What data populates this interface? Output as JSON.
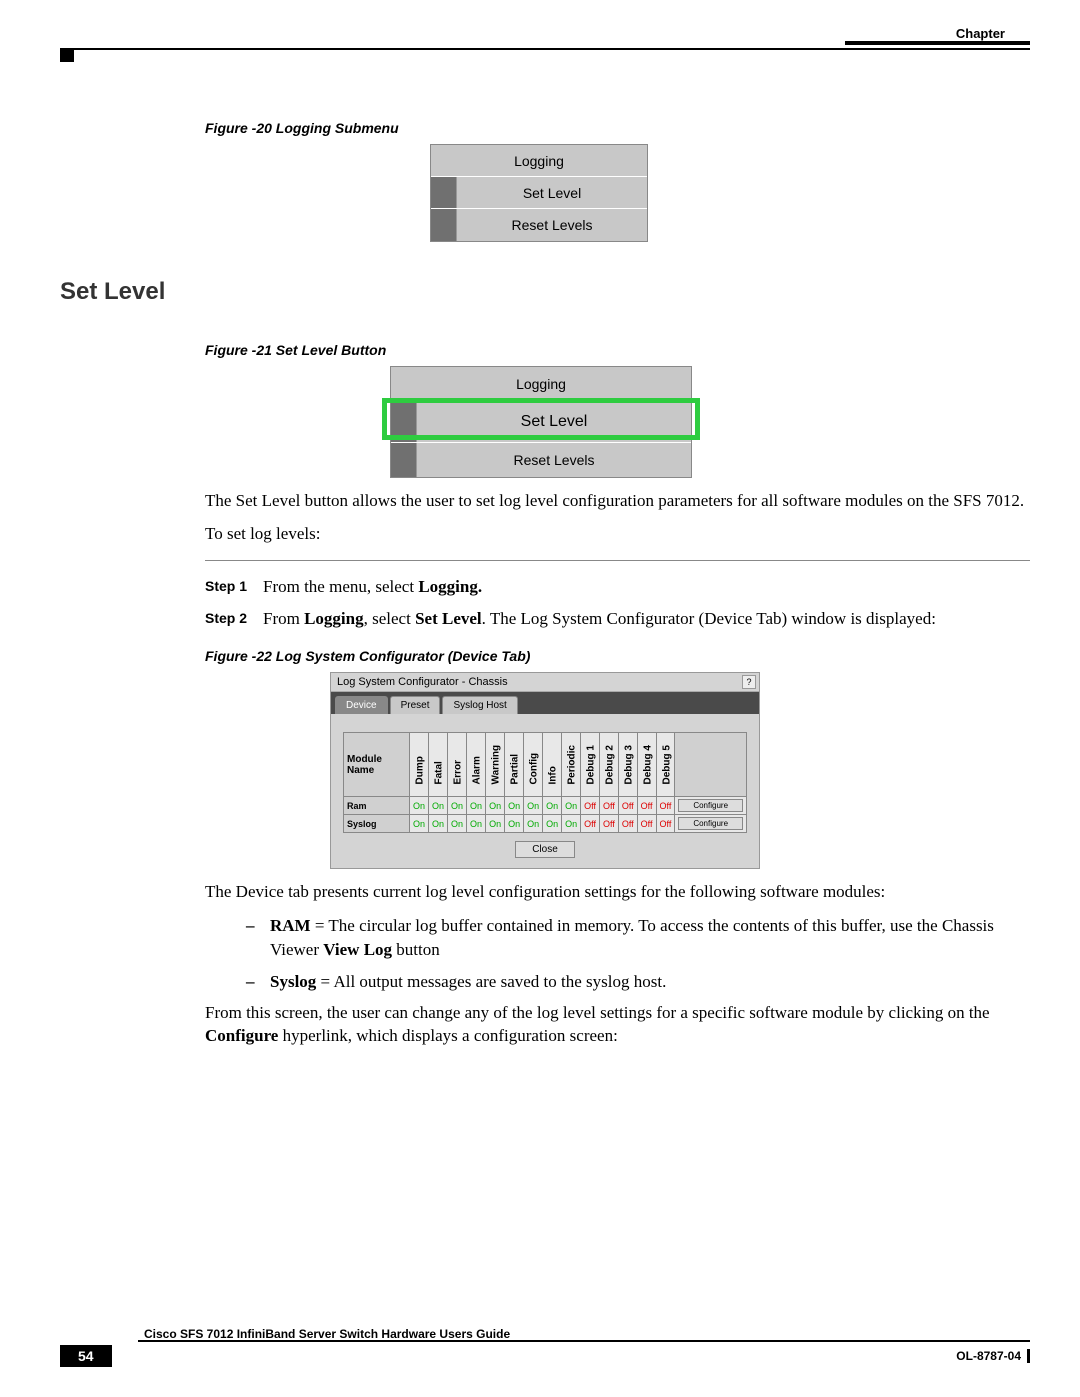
{
  "header": {
    "chapter": "Chapter"
  },
  "figures": {
    "f20": {
      "caption": "Figure -20   Logging Submenu",
      "items": [
        "Logging",
        "Set Level",
        "Reset Levels"
      ]
    },
    "f21": {
      "caption": "Figure -21   Set Level Button",
      "items": [
        "Logging",
        "Set Level",
        "Reset Levels"
      ]
    },
    "f22": {
      "caption": "Figure -22   Log System Configurator (Device Tab)",
      "window_title": "Log System Configurator - Chassis",
      "tabs": [
        "Device",
        "Preset",
        "Syslog Host"
      ],
      "columns": [
        "Module Name",
        "Dump",
        "Fatal",
        "Error",
        "Alarm",
        "Warning",
        "Partial",
        "Config",
        "Info",
        "Periodic",
        "Debug 1",
        "Debug 2",
        "Debug 3",
        "Debug 4",
        "Debug 5"
      ],
      "rows": [
        {
          "name": "Ram",
          "values": [
            "On",
            "On",
            "On",
            "On",
            "On",
            "On",
            "On",
            "On",
            "On",
            "Off",
            "Off",
            "Off",
            "Off",
            "Off"
          ],
          "btn": "Configure"
        },
        {
          "name": "Syslog",
          "values": [
            "On",
            "On",
            "On",
            "On",
            "On",
            "On",
            "On",
            "On",
            "On",
            "Off",
            "Off",
            "Off",
            "Off",
            "Off"
          ],
          "btn": "Configure"
        }
      ],
      "close": "Close"
    }
  },
  "section_heading": "Set Level",
  "paragraphs": {
    "p1a": "The Set Level button allows the user to set log level configuration parameters for all software modules on the SFS 7012.",
    "p1b": "To set log levels:",
    "p2": "The Device tab presents current log level configuration settings for the following software modules:",
    "p3a": "From this screen, the user can change any of the log level settings for a specific software module by clicking on the ",
    "p3b": " hyperlink, which displays a configuration screen:"
  },
  "steps": {
    "s1_label": "Step 1",
    "s1_a": "From the menu, select ",
    "s1_b": "Logging.",
    "s2_label": "Step 2",
    "s2_a": "From ",
    "s2_b": "Logging",
    "s2_c": ", select ",
    "s2_d": "Set Level",
    "s2_e": ". The Log System Configurator (Device Tab) window is displayed:"
  },
  "bullets": {
    "b1_a": "RAM",
    "b1_b": " = The circular log buffer contained in memory. To access the contents of this buffer, use the Chassis Viewer ",
    "b1_c": "View Log",
    "b1_d": " button",
    "b2_a": "Syslog",
    "b2_b": " = All output messages are saved to the syslog host."
  },
  "inline": {
    "configure": "Configure"
  },
  "footer": {
    "page": "54",
    "title": "Cisco SFS 7012 InfiniBand Server Switch Hardware Users Guide",
    "doc": "OL-8787-04"
  }
}
